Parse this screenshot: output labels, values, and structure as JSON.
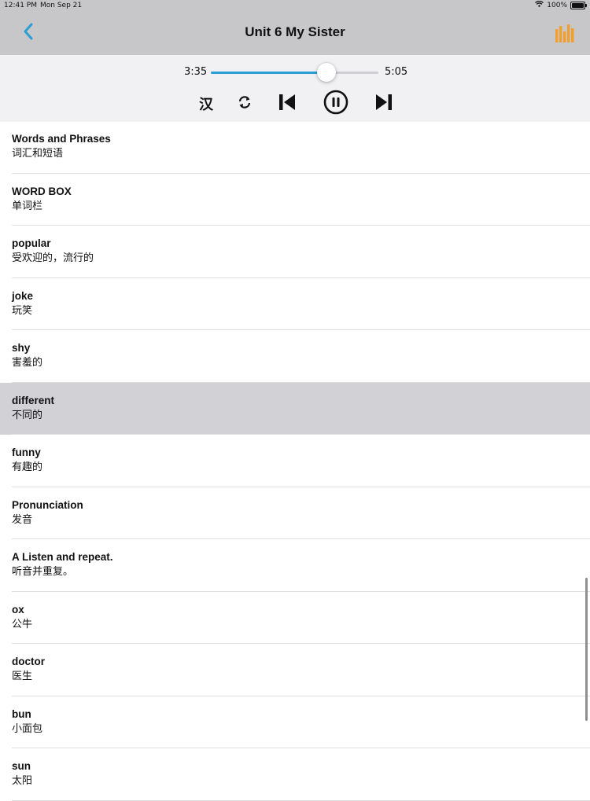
{
  "status_bar": {
    "time": "12:41 PM",
    "date": "Mon Sep 21",
    "battery": "100%",
    "battery_level": 1.0
  },
  "nav": {
    "title": "Unit 6 My Sister",
    "back_icon": "chevron-left-icon",
    "chart_icon": "bar-chart-icon",
    "accent_color": "#2a9fd6",
    "chart_color": "#f0a030"
  },
  "player": {
    "current_time": "3:35",
    "total_time": "5:05",
    "progress": 0.69,
    "han_label": "汉",
    "controls": [
      "han-toggle",
      "repeat-icon",
      "previous-icon",
      "pause-icon",
      "next-icon"
    ]
  },
  "items": [
    {
      "en": "Words and Phrases",
      "zh": "词汇和短语"
    },
    {
      "en": "WORD BOX",
      "zh": "单词栏"
    },
    {
      "en": "popular",
      "zh": "受欢迎的，流行的"
    },
    {
      "en": "joke",
      "zh": "玩笑"
    },
    {
      "en": "shy",
      "zh": "害羞的"
    },
    {
      "en": "different",
      "zh": "不同的"
    },
    {
      "en": "funny",
      "zh": "有趣的"
    },
    {
      "en": "Pronunciation",
      "zh": "发音"
    },
    {
      "en": "A Listen and repeat.",
      "zh": "听音并重复。"
    },
    {
      "en": "ox",
      "zh": "公牛"
    },
    {
      "en": "doctor",
      "zh": "医生"
    },
    {
      "en": "bun",
      "zh": "小面包"
    },
    {
      "en": "sun",
      "zh": "太阳"
    }
  ],
  "selected_index": 5
}
